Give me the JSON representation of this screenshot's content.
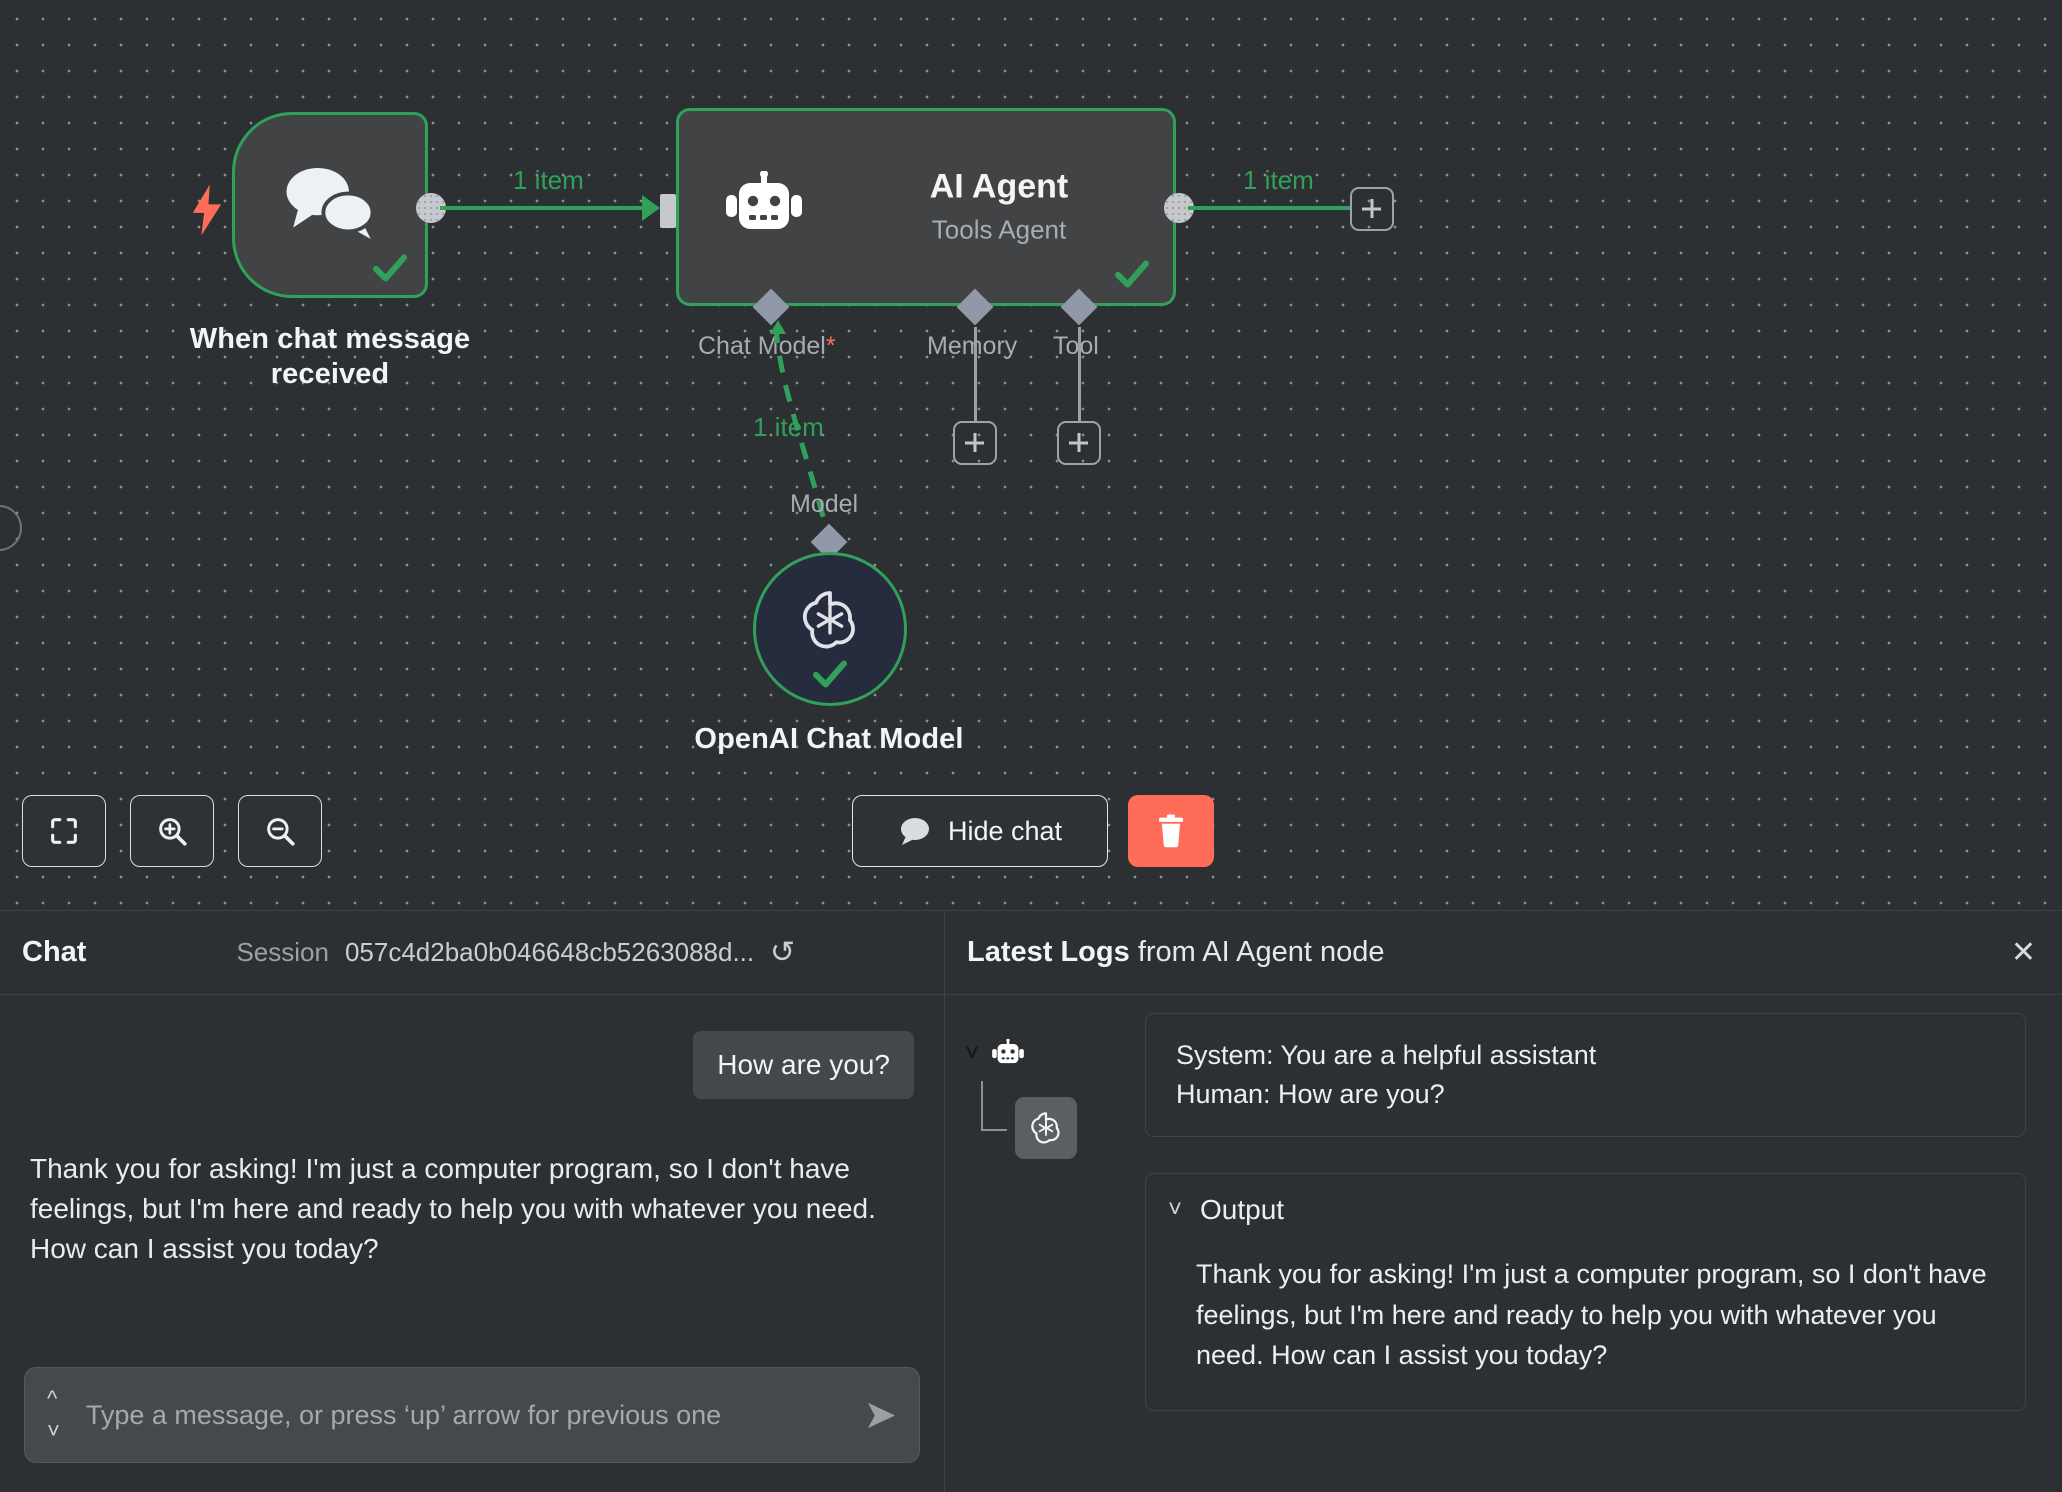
{
  "canvas": {
    "trigger_node": {
      "label": "When chat message received",
      "icon": "chat-bubbles-icon",
      "status": "success"
    },
    "agent_node": {
      "title": "AI Agent",
      "subtitle": "Tools Agent",
      "icon": "robot-icon",
      "status": "success",
      "ports": {
        "chat_model": "Chat Model",
        "chat_model_required_marker": "*",
        "memory": "Memory",
        "tool": "Tool"
      }
    },
    "openai_node": {
      "label": "OpenAI Chat Model",
      "port_label": "Model",
      "icon": "openai-icon",
      "status": "success"
    },
    "connections": {
      "trigger_to_agent": "1 item",
      "agent_output": "1 item",
      "model_to_agent": "1 item"
    },
    "add_buttons": {
      "main_output": "+",
      "memory": "+",
      "tool": "+"
    },
    "colors": {
      "success_green": "#31a05a",
      "danger_red": "#ff6d5a",
      "node_fill": "#424345",
      "canvas_bg": "#2c3032"
    }
  },
  "toolbar": {
    "fit_view": "fit-view-icon",
    "zoom_in": "zoom-in-icon",
    "zoom_out": "zoom-out-icon",
    "hide_chat_label": "Hide chat",
    "hide_chat_icon": "chat-bubble-icon",
    "delete_icon": "trash-icon"
  },
  "chat": {
    "title": "Chat",
    "session_label": "Session",
    "session_id": "057c4d2ba0b046648cb5263088d...",
    "refresh_icon": "refresh-icon",
    "messages": [
      {
        "role": "user",
        "text": "How are you?"
      },
      {
        "role": "assistant",
        "text": "Thank you for asking! I'm just a computer program, so I don't have feelings, but I'm here and ready to help you with whatever you need. How can I assist you today?"
      }
    ],
    "input": {
      "value": "",
      "placeholder": "Type a message, or press ‘up’ arrow for previous one"
    },
    "history_up_icon": "chevron-up-icon",
    "history_down_icon": "chevron-down-icon",
    "send_icon": "send-icon"
  },
  "logs": {
    "title_bold": "Latest Logs",
    "title_rest": "from AI Agent node",
    "close_icon": "close-icon",
    "tree": {
      "root_icon": "robot-icon",
      "child_icon": "openai-icon",
      "expand_icon": "chevron-down-icon"
    },
    "input_card": {
      "lines": [
        "System: You are a helpful assistant",
        "Human: How are you?"
      ]
    },
    "output_card": {
      "label": "Output",
      "expand_icon": "chevron-down-icon",
      "text": "Thank you for asking! I'm just a computer program, so I don't have feelings, but I'm here and ready to help you with whatever you need. How can I assist you today?"
    }
  }
}
